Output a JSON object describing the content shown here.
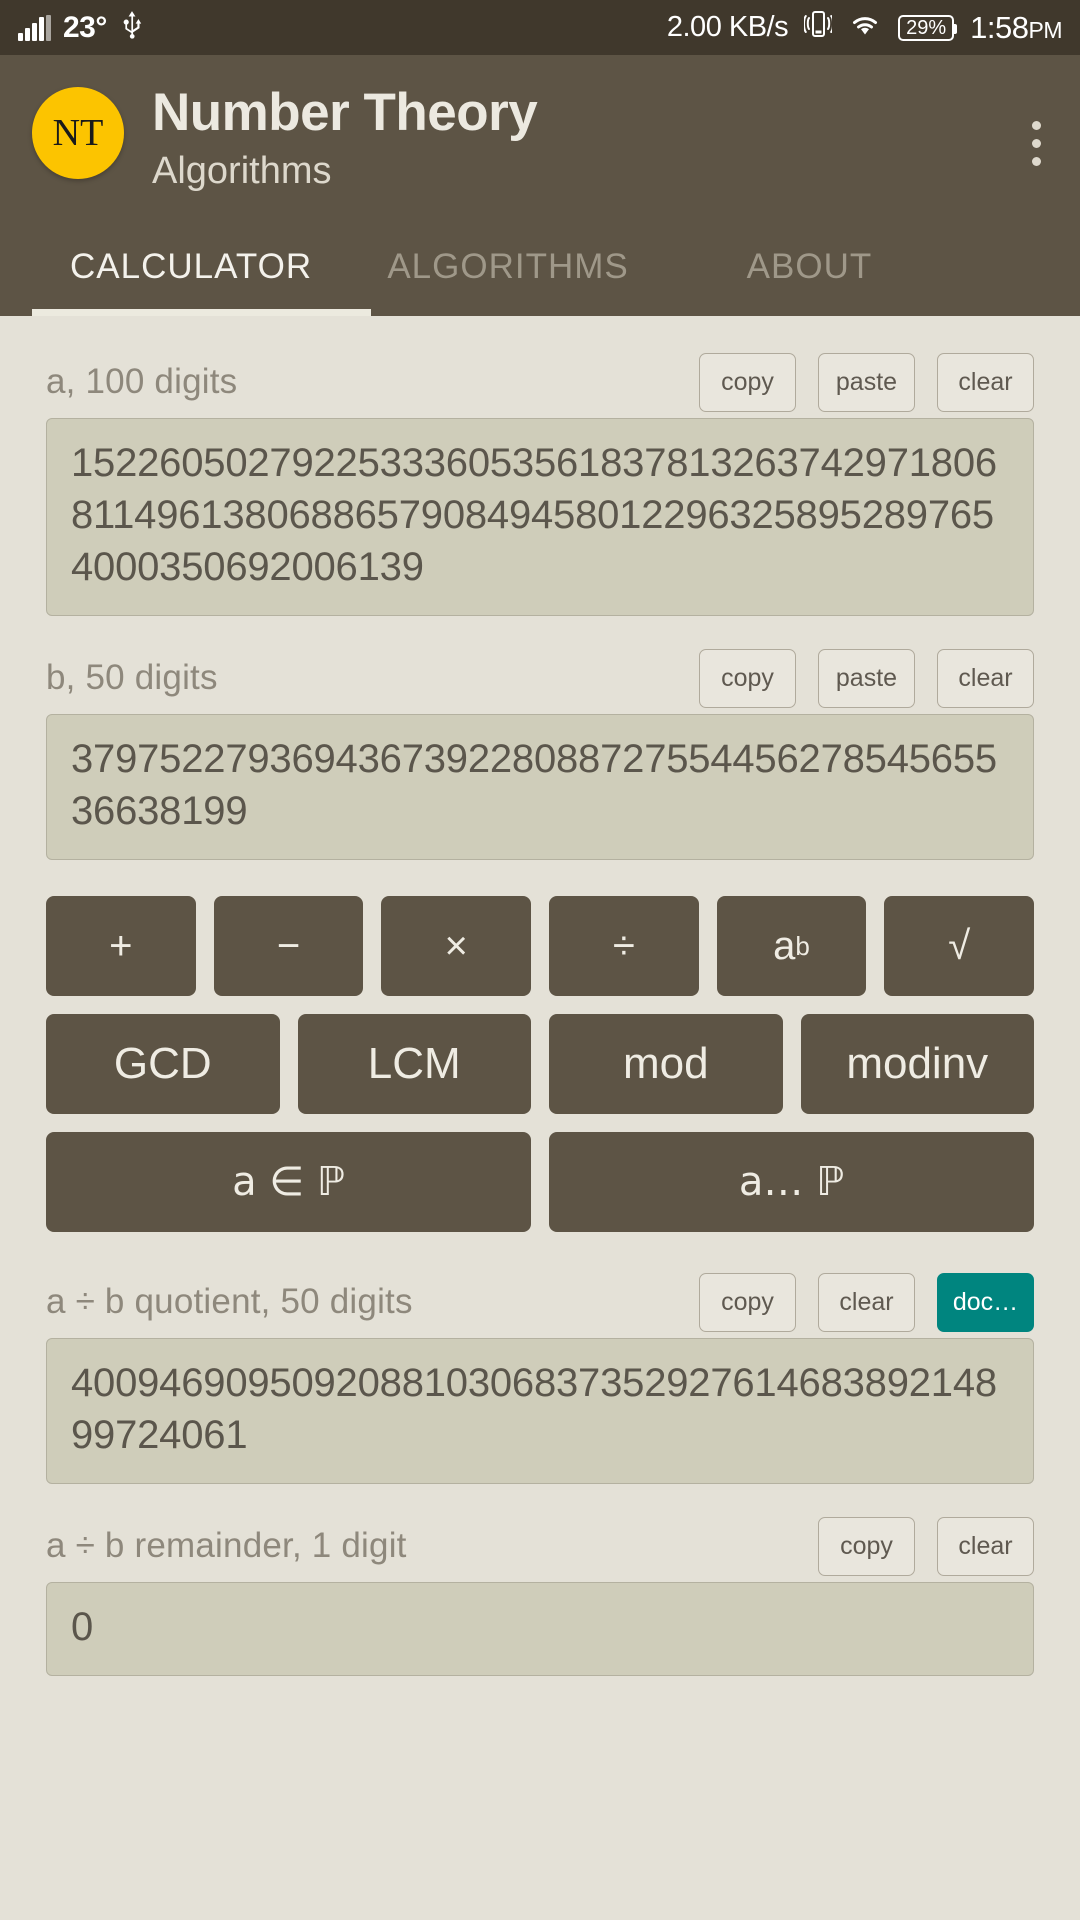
{
  "statusbar": {
    "signal_icon": "signal-bars-icon",
    "temperature": "23°",
    "usb_icon": "usb-icon",
    "network_speed": "2.00 KB/s",
    "vibrate_icon": "vibrate-icon",
    "wifi_icon": "wifi-icon",
    "battery": "29%",
    "time": "1:58",
    "ampm": "PM"
  },
  "appbar": {
    "logo_text": "NT",
    "title": "Number Theory",
    "subtitle": "Algorithms",
    "overflow_icon": "kebab-menu-icon"
  },
  "tabs": [
    {
      "label": "CALCULATOR",
      "active": true
    },
    {
      "label": "ALGORITHMS",
      "active": false
    },
    {
      "label": "ABOUT",
      "active": false
    }
  ],
  "fields": {
    "a": {
      "label": "a, 100 digits",
      "value": "1522605027922533360535618378132637429718068114961380688657908494580122963258952897654000350692006139",
      "buttons": [
        "copy",
        "paste",
        "clear"
      ]
    },
    "b": {
      "label": "b, 50 digits",
      "value": "37975227936943673922808872755445627854565536638199",
      "buttons": [
        "copy",
        "paste",
        "clear"
      ]
    },
    "quotient": {
      "label": "a ÷ b quotient, 50 digits",
      "value": "40094690950920881030683735292761468389214899724061",
      "buttons": [
        "copy",
        "clear",
        "doc…"
      ]
    },
    "remainder": {
      "label": "a ÷ b remainder, 1 digit",
      "value": "0",
      "buttons": [
        "copy",
        "clear"
      ]
    }
  },
  "keypad": {
    "ops": [
      "+",
      "−",
      "×",
      "÷",
      "a",
      "√"
    ],
    "op_exponent": "b",
    "names": [
      "GCD",
      "LCM",
      "mod",
      "modinv"
    ],
    "primes": [
      "a ∈ ℙ",
      "a… ℙ"
    ]
  },
  "colors": {
    "statusbar_bg": "#40382c",
    "appbar_bg": "#5d5445",
    "page_bg": "#e4e1d7",
    "input_bg": "#cfcdba",
    "accent_logo": "#fcc400",
    "accent_doc": "#00857f"
  }
}
